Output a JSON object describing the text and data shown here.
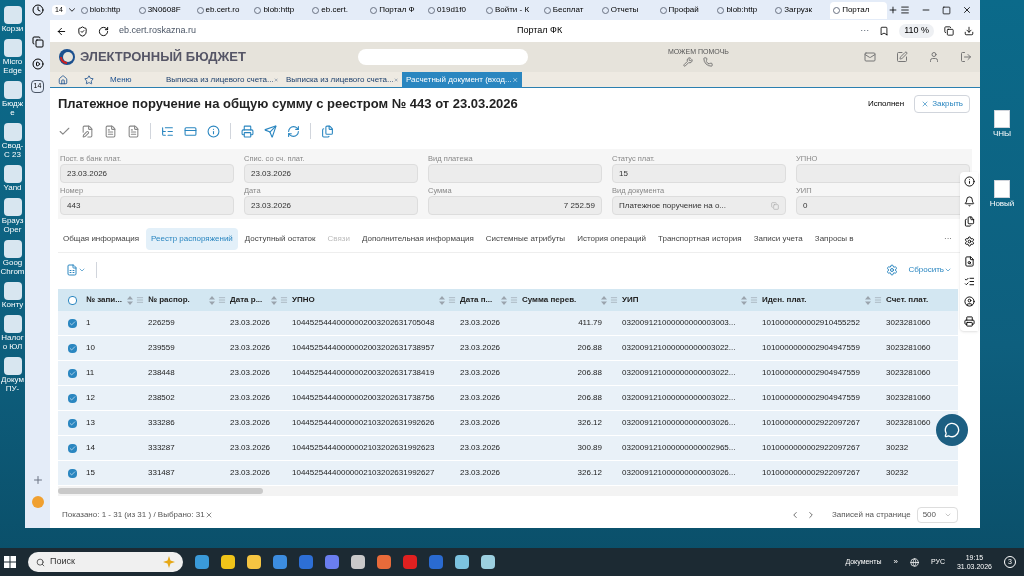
{
  "desktop": {
    "left": [
      "Корзи",
      "Micro Edge",
      "Бюдже",
      "Свод-С 23",
      "Yand",
      "Брауз Oper",
      "Goog Chrom",
      "Конту",
      "Налого ЮЛ",
      "Докум ПУ-"
    ],
    "right": [
      "ЧНЫ",
      "Новый"
    ]
  },
  "browser": {
    "tab_counter": "14",
    "tabs": [
      {
        "title": "blob:http",
        "selected": false
      },
      {
        "title": "3N0608F",
        "selected": false
      },
      {
        "title": "eb.cert.ro",
        "selected": false
      },
      {
        "title": "blob:http",
        "selected": false
      },
      {
        "title": "eb.cert.",
        "selected": false
      },
      {
        "title": "Портал Ф",
        "selected": false
      },
      {
        "title": "019d1f0",
        "selected": false
      },
      {
        "title": "Войти - К",
        "selected": false
      },
      {
        "title": "Бесплат",
        "selected": false
      },
      {
        "title": "Отчеты",
        "selected": false
      },
      {
        "title": "Профай",
        "selected": false
      },
      {
        "title": "blob:http",
        "selected": false
      },
      {
        "title": "Загрузк",
        "selected": false
      },
      {
        "title": "Портал",
        "selected": true
      }
    ],
    "sidebar_badge": "14",
    "address": "eb.cert.roskazna.ru",
    "page_title": "Портал ФК",
    "more": "···",
    "zoom": "110 %"
  },
  "app": {
    "logo": "ЭЛЕКТРОННЫЙ БЮДЖЕТ",
    "help": "МОЖЕМ ПОМОЧЬ",
    "menu": "Меню",
    "tabs": [
      {
        "title": "Выписка из лицевого счета...",
        "selected": false
      },
      {
        "title": "Выписка из лицевого счета...",
        "selected": false
      },
      {
        "title": "Расчетный документ (вход...",
        "selected": true
      }
    ]
  },
  "document": {
    "title": "Платежное поручение на общую сумму с реестром № 443 от 23.03.2026",
    "status": "Исполнен",
    "close": "Закрыть",
    "toolbar": [
      {
        "disabled": true
      },
      {
        "disabled": true
      },
      {
        "disabled": true
      },
      {
        "disabled": true
      },
      {
        "disabled": false
      },
      {
        "disabled": false
      },
      {
        "disabled": false
      },
      {
        "disabled": false
      },
      {
        "disabled": false
      },
      {
        "disabled": false
      },
      {
        "disabled": false
      }
    ],
    "fields": [
      {
        "label": "Пост. в банк плат.",
        "value": "23.03.2026",
        "kind": "text"
      },
      {
        "label": "Спис. со сч. плат.",
        "value": "23.03.2026",
        "kind": "text"
      },
      {
        "label": "Вид платежа",
        "kind": "text"
      },
      {
        "label": "Статус плат.",
        "value": "15",
        "kind": "text"
      },
      {
        "label": "УПНО",
        "kind": "text"
      },
      {
        "label": "Номер",
        "value": "443",
        "kind": "text"
      },
      {
        "label": "Дата",
        "value": "23.03.2026",
        "kind": "text"
      },
      {
        "label": "Сумма",
        "value": "7 252.59",
        "kind": "amount"
      },
      {
        "label": "Вид документа",
        "value": "Платежное поручение на о...",
        "kind": "copy"
      },
      {
        "label": "УИП",
        "value": "0",
        "kind": "text"
      }
    ],
    "tabs": [
      {
        "label": "Общая информация",
        "selected": false,
        "disabled": false
      },
      {
        "label": "Реестр распоряжений",
        "selected": true,
        "disabled": false
      },
      {
        "label": "Доступный остаток",
        "selected": false,
        "disabled": false
      },
      {
        "label": "Связи",
        "selected": false,
        "disabled": true
      },
      {
        "label": "Дополнительная информация",
        "selected": false,
        "disabled": false
      },
      {
        "label": "Системные атрибуты",
        "selected": false,
        "disabled": false
      },
      {
        "label": "История операций",
        "selected": false,
        "disabled": false
      },
      {
        "label": "Транспортная история",
        "selected": false,
        "disabled": false
      },
      {
        "label": "Записи учета",
        "selected": false,
        "disabled": false
      },
      {
        "label": "Запросы в",
        "selected": false,
        "disabled": false
      }
    ],
    "more": "···",
    "reset": "Сбросить"
  },
  "table": {
    "select_all": {
      "checked": false
    },
    "columns": [
      "№ запи...",
      "№ распор.",
      "Дата р...",
      "УПНО",
      "Дата п...",
      "Сумма перев.",
      "УИП",
      "Иден. плат.",
      "Счет. плат."
    ],
    "rows": [
      {
        "selected": true,
        "cells": [
          "1",
          "226259",
          "23.03.2026",
          "10445254440000002003202631705048",
          "23.03.2026",
          "411.79",
          "032009121000000000003003...",
          "1010000000002910455252",
          "3023281060"
        ]
      },
      {
        "selected": true,
        "cells": [
          "10",
          "239559",
          "23.03.2026",
          "10445254440000002003202631738957",
          "23.03.2026",
          "206.88",
          "032009121000000000003022...",
          "1010000000002904947559",
          "3023281060"
        ]
      },
      {
        "selected": true,
        "cells": [
          "11",
          "238448",
          "23.03.2026",
          "10445254440000002003202631738419",
          "23.03.2026",
          "206.88",
          "032009121000000000003022...",
          "1010000000002904947559",
          "3023281060"
        ]
      },
      {
        "selected": true,
        "cells": [
          "12",
          "238502",
          "23.03.2026",
          "10445254440000002003202631738756",
          "23.03.2026",
          "206.88",
          "032009121000000000003022...",
          "1010000000002904947559",
          "3023281060"
        ]
      },
      {
        "selected": true,
        "cells": [
          "13",
          "333286",
          "23.03.2026",
          "10445254440000002103202631992626",
          "23.03.2026",
          "326.12",
          "032009121000000000003026...",
          "1010000000002922097267",
          "3023281060"
        ]
      },
      {
        "selected": true,
        "cells": [
          "14",
          "333287",
          "23.03.2026",
          "10445254440000002103202631992623",
          "23.03.2026",
          "300.89",
          "032009121000000000002965...",
          "1010000000002922097267",
          "30232"
        ]
      },
      {
        "selected": true,
        "cells": [
          "15",
          "331487",
          "23.03.2026",
          "10445254440000002103202631992627",
          "23.03.2026",
          "326.12",
          "032009121000000000003026...",
          "1010000000002922097267",
          "30232"
        ]
      }
    ],
    "footer": "Показано: 1 - 31 (из 31 ) / Выбрано: 31",
    "per_page_label": "Записей на странице",
    "per_page": "500"
  },
  "taskbar": {
    "search": "Поиск",
    "documents": "Документы",
    "chevron": "»",
    "lang": "РУС",
    "time": "19:15",
    "date": "31.03.2026",
    "notifications": "3"
  }
}
